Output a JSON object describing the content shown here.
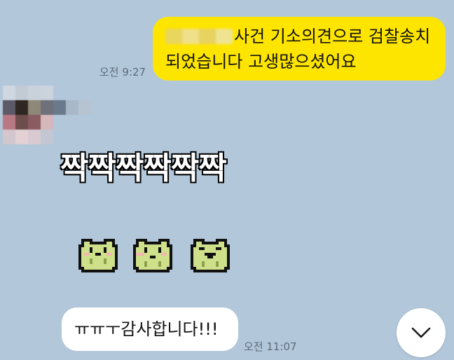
{
  "messages": {
    "outgoing": {
      "line1": "사건 기소의견으로 검찰송치",
      "line2": "되었습니다 고생많으셨어요",
      "time": "오전 9:27"
    },
    "sticker_text": "짝짝짝짝짝짝",
    "incoming": {
      "text": "ㅠㅠㅜ감사합니다!!!",
      "time": "오전 11:07"
    }
  },
  "icons": {
    "scroll_down": "chevron-down-icon",
    "emoticon": "frog-icon"
  },
  "colors": {
    "background": "#b2c7da",
    "outgoing_bubble": "#fee500",
    "incoming_bubble": "#ffffff",
    "frog_body": "#cfe08a",
    "frog_cheek": "#f4b6b0"
  }
}
